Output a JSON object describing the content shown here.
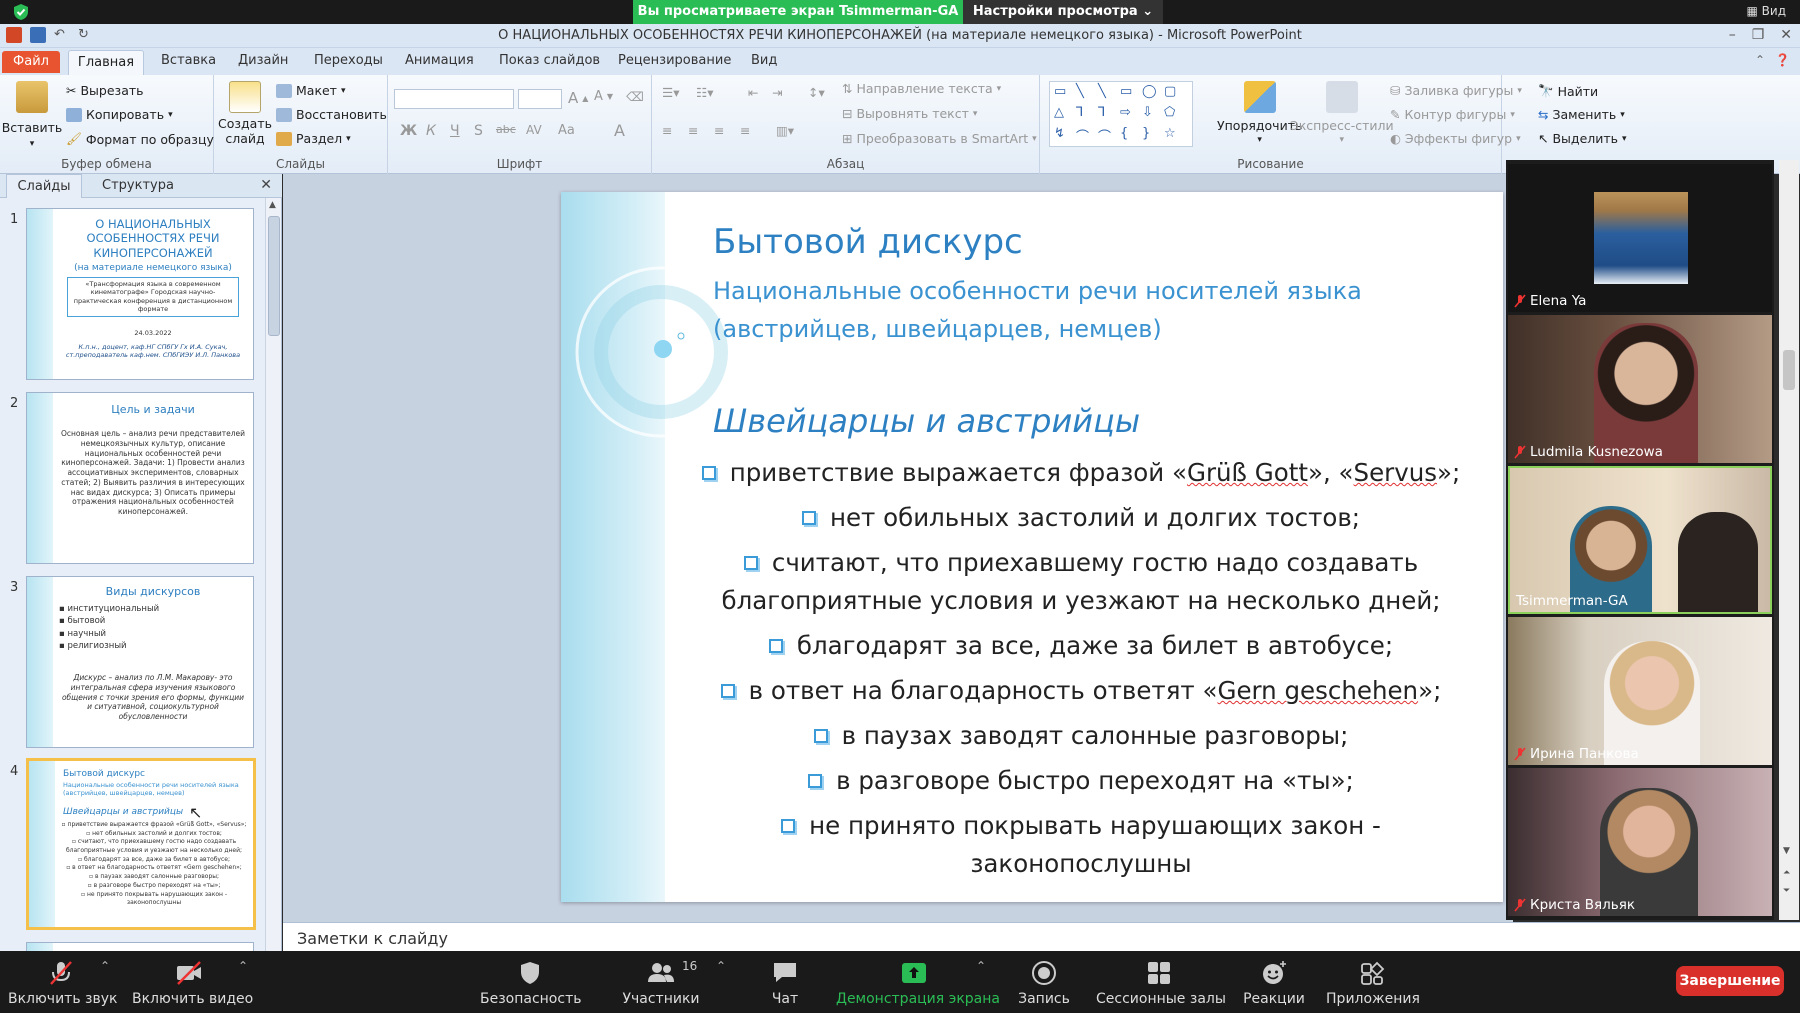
{
  "zoom": {
    "sharing_banner": "Вы просматриваете экран Tsimmerman-GA",
    "view_options": "Настройки просмотра",
    "view_menu": "Вид",
    "toolbar": {
      "unmute": "Включить звук",
      "start_video": "Включить видео",
      "security": "Безопасность",
      "participants": "Участники",
      "participants_count": "16",
      "chat": "Чат",
      "share_screen": "Демонстрация экрана",
      "record": "Запись",
      "breakout": "Сессионные залы",
      "reactions": "Реакции",
      "apps": "Приложения",
      "end": "Завершение"
    },
    "participants": [
      {
        "name": "Elena Ya"
      },
      {
        "name": "Ludmila Kusnezowa"
      },
      {
        "name": "Tsimmerman-GA"
      },
      {
        "name": "Ирина Панкова"
      },
      {
        "name": "Криста Вяльяк"
      }
    ]
  },
  "ppt": {
    "window_title": "О  НАЦИОНАЛЬНЫХ ОСОБЕННОСТЯХ РЕЧИ КИНОПЕРСОНАЖЕЙ (на материале немецкого языка)  -  Microsoft PowerPoint",
    "tabs": [
      "Файл",
      "Главная",
      "Вставка",
      "Дизайн",
      "Переходы",
      "Анимация",
      "Показ слайдов",
      "Рецензирование",
      "Вид"
    ],
    "ribbon": {
      "clipboard": {
        "label": "Буфер обмена",
        "paste": "Вставить",
        "cut": "Вырезать",
        "copy": "Копировать",
        "format_painter": "Формат по образцу"
      },
      "slides": {
        "label": "Слайды",
        "new_slide_1": "Создать",
        "new_slide_2": "слайд",
        "layout": "Макет",
        "reset": "Восстановить",
        "section": "Раздел"
      },
      "font": {
        "label": "Шрифт"
      },
      "paragraph": {
        "label": "Абзац",
        "text_direction": "Направление текста",
        "align_text": "Выровнять текст",
        "smartart": "Преобразовать в SmartArt"
      },
      "drawing": {
        "label": "Рисование",
        "arrange": "Упорядочить",
        "quick_styles": "Экспресс-стили",
        "shape_fill": "Заливка фигуры",
        "shape_outline": "Контур фигуры",
        "shape_effects": "Эффекты фигур"
      },
      "editing": {
        "find": "Найти",
        "replace": "Заменить",
        "select": "Выделить"
      }
    },
    "panel": {
      "tab_slides": "Слайды",
      "tab_outline": "Структура"
    },
    "notes_placeholder": "Заметки к слайду",
    "thumbs": [
      {
        "num": "1",
        "title": "О  НАЦИОНАЛЬНЫХ ОСОБЕННОСТЯХ РЕЧИ КИНОПЕРСОНАЖЕЙ",
        "subtitle": "(на материале немецкого языка)",
        "box": "«Трансформация языка в современном кинематографе» Городская научно-практическая конференция в дистанционном формате",
        "date": "24.03.2022",
        "authors": "К.п.н., доцент, каф.НГ СПбГУ Гх И.А. Сукач, ст.преподаватель каф.нем. СПбГИЭУ И.Л. Панкова"
      },
      {
        "num": "2",
        "title": "Цель и задачи",
        "text": "Основная цель – анализ речи представителей немецкоязычных культур, описание национальных особенностей речи киноперсонажей. Задачи: 1) Провести анализ ассоциативных экспериментов, словарных статей; 2) Выявить различия в интересующих нас видах дискурса; 3) Описать примеры отражения национальных особенностей киноперсонажей."
      },
      {
        "num": "3",
        "title": "Виды дискурсов",
        "items": [
          "институциональный",
          "бытовой",
          "научный",
          "религиозный"
        ],
        "text": "Дискурс – анализ по Л.М. Макарову- это интегральная сфера изучения языкового общения с точки зрения его формы, функции и ситуативной, социокультурной обусловленности"
      },
      {
        "num": "4",
        "title": "Бытовой дискурс",
        "subtitle": "Национальные особенности речи носителей языка (австрийцев, швейцарцев, немцев)",
        "h2": "Швейцарцы и австрийцы",
        "lines": [
          "приветствие выражается фразой «Grüß Gott», «Servus»;",
          "нет обильных застолий и долгих тостов;",
          "считают, что приехавшему гостю надо создавать благоприятные условия и уезжают на несколько дней;",
          "благодарят за все, даже за билет в автобусе;",
          "в ответ на благодарность ответят «Gern geschehen»;",
          "в паузах заводят салонные разговоры;",
          "в разговоре быстро переходят на «ты»;",
          "не принято покрывать нарушающих закон - законопослушны"
        ]
      }
    ],
    "slide": {
      "title": "Бытовой дискурс",
      "subtitle_1": "Национальные особенности речи носителей языка",
      "subtitle_2": "(австрийцев, швейцарцев, немцев)",
      "heading": "Швейцарцы и австрийцы",
      "b1_pre": "приветствие выражается фразой «",
      "b1_w1": "Grüß Gott",
      "b1_mid": "», «",
      "b1_w2": "Servus",
      "b1_post": "»;",
      "b2": "нет обильных застолий и долгих тостов;",
      "b3_1": "считают, что приехавшему гостю надо создавать",
      "b3_2": "благоприятные условия и уезжают на несколько дней;",
      "b4": "благодарят за все, даже за билет в автобусе;",
      "b5_pre": "в ответ на благодарность ответят «",
      "b5_w": "Gern geschehen",
      "b5_post": "»;",
      "b6": "в паузах заводят салонные разговоры;",
      "b7": "в разговоре быстро переходят на «ты»;",
      "b8_1": "не принято покрывать нарушающих закон -",
      "b8_2": "законопослушны"
    }
  },
  "colors": {
    "zoom_green": "#2bbd55",
    "file_tab": "#e8542f",
    "slide_blue": "#2d80c2",
    "end_red": "#d9302b"
  }
}
